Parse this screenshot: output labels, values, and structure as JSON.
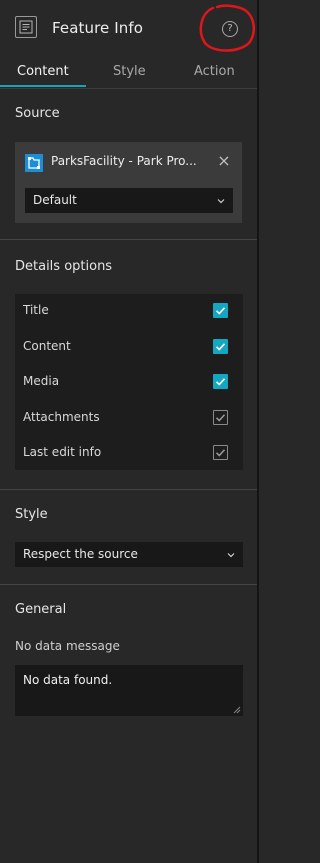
{
  "header": {
    "title": "Feature Info",
    "help_icon_glyph": "?"
  },
  "tabs": [
    {
      "label": "Content",
      "active": true
    },
    {
      "label": "Style",
      "active": false
    },
    {
      "label": "Action",
      "active": false
    }
  ],
  "source": {
    "section_title": "Source",
    "data_source_name": "ParksFacility - Park Pro...",
    "view_select": "Default"
  },
  "details_options": {
    "section_title": "Details options",
    "items": [
      {
        "label": "Title",
        "checked": true,
        "disabled": false
      },
      {
        "label": "Content",
        "checked": true,
        "disabled": false
      },
      {
        "label": "Media",
        "checked": true,
        "disabled": false
      },
      {
        "label": "Attachments",
        "checked": true,
        "disabled": true
      },
      {
        "label": "Last edit info",
        "checked": true,
        "disabled": true
      }
    ]
  },
  "style": {
    "section_title": "Style",
    "select_value": "Respect the source"
  },
  "general": {
    "section_title": "General",
    "no_data_label": "No data message",
    "no_data_value": "No data found."
  },
  "colors": {
    "accent": "#1aa3b8",
    "checkbox": "#15a7c2",
    "annotation": "#e0161b"
  }
}
